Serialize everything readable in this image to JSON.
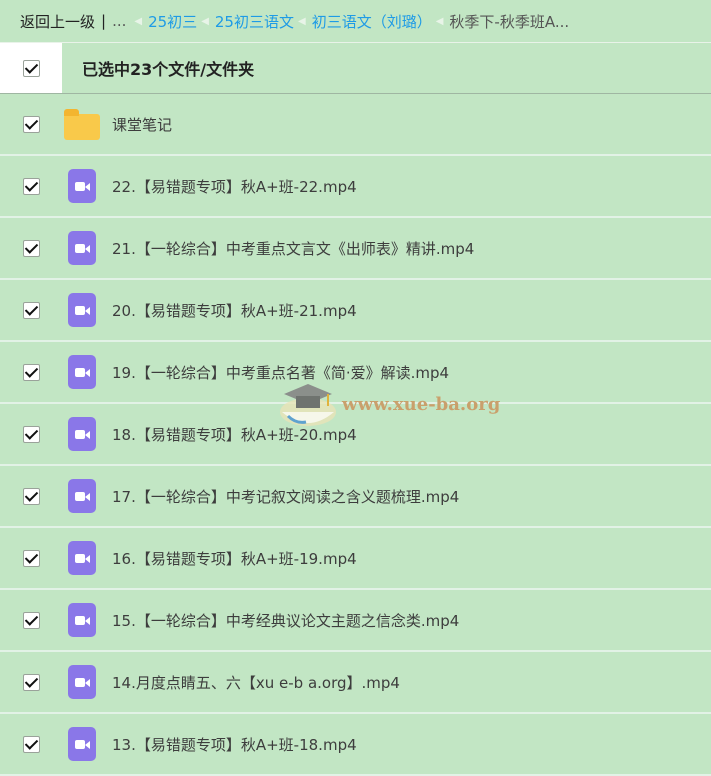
{
  "breadcrumb": {
    "back": "返回上一级",
    "separator": "|",
    "ellipsis": "...",
    "links": [
      "25初三",
      "25初三语文",
      "初三语文（刘璐）"
    ],
    "current": "秋季下-秋季班A..."
  },
  "selection": {
    "label": "已选中23个文件/文件夹"
  },
  "files": [
    {
      "name": "课堂笔记",
      "type": "folder"
    },
    {
      "name": "22.【易错题专项】秋A+班-22.mp4",
      "type": "video"
    },
    {
      "name": "21.【一轮综合】中考重点文言文《出师表》精讲.mp4",
      "type": "video"
    },
    {
      "name": "20.【易错题专项】秋A+班-21.mp4",
      "type": "video"
    },
    {
      "name": "19.【一轮综合】中考重点名著《简·爱》解读.mp4",
      "type": "video"
    },
    {
      "name": "18.【易错题专项】秋A+班-20.mp4",
      "type": "video"
    },
    {
      "name": "17.【一轮综合】中考记叙文阅读之含义题梳理.mp4",
      "type": "video"
    },
    {
      "name": "16.【易错题专项】秋A+班-19.mp4",
      "type": "video"
    },
    {
      "name": "15.【一轮综合】中考经典议论文主题之信念类.mp4",
      "type": "video"
    },
    {
      "name": "14.月度点睛五、六【xu e-b a.org】.mp4",
      "type": "video"
    },
    {
      "name": "13.【易错题专项】秋A+班-18.mp4",
      "type": "video"
    }
  ],
  "watermark": "www.xue-ba.org",
  "colors": {
    "background": "#c2e6c4",
    "link": "#1e9be6",
    "video_icon": "#8a77e8",
    "folder_icon": "#f9c94a"
  }
}
